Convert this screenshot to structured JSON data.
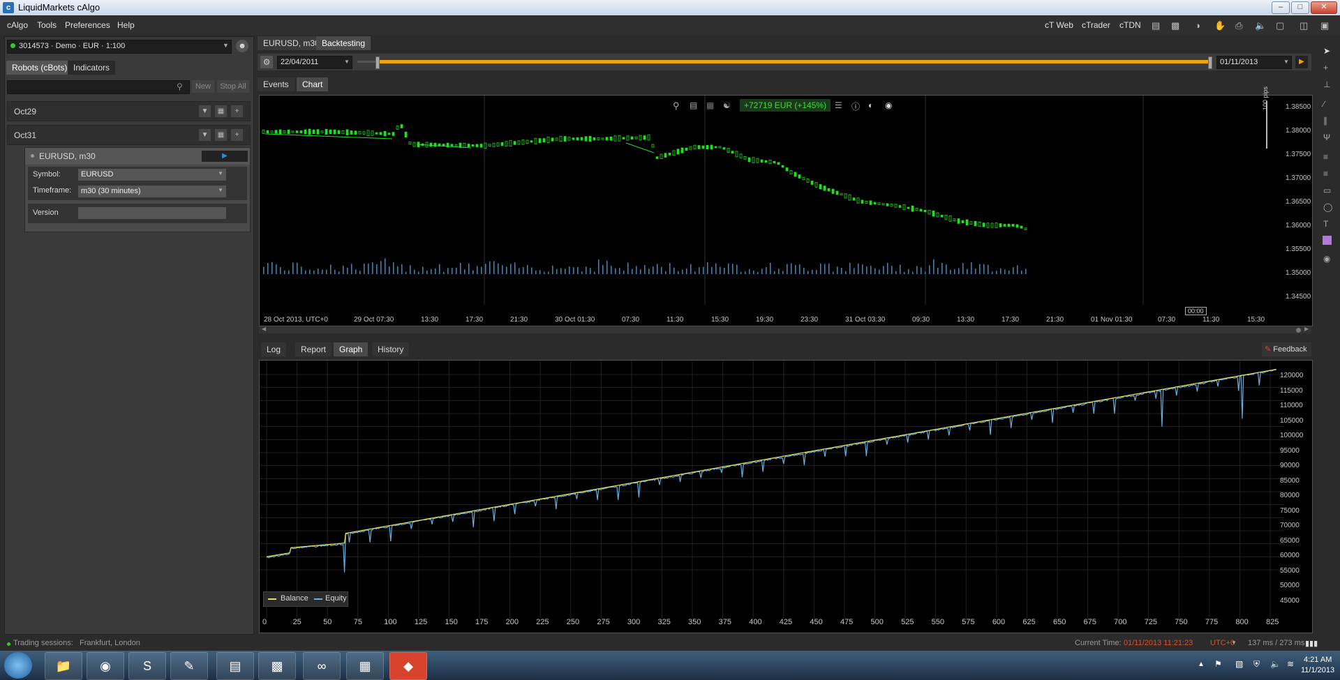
{
  "window": {
    "title": "LiquidMarkets cAlgo",
    "minimize": "–",
    "maximize": "□",
    "close": "✕"
  },
  "menu": {
    "items": [
      "cAlgo",
      "Tools",
      "Preferences",
      "Help"
    ],
    "right_links": [
      "cT Web",
      "cTrader",
      "cTDN"
    ]
  },
  "account": {
    "selector": "3014573 · Demo · EUR · 1:100"
  },
  "left_tabs": [
    "Robots (cBots)",
    "Indicators"
  ],
  "left_toolbar": {
    "search_placeholder": "",
    "new": "New",
    "stop_all": "Stop All"
  },
  "robots": [
    {
      "name": "Oct29"
    },
    {
      "name": "Oct31",
      "instance": {
        "title": "EURUSD, m30",
        "params": [
          {
            "label": "Symbol:",
            "value": "EURUSD"
          },
          {
            "label": "Timeframe:",
            "value": "m30 (30 minutes)"
          }
        ],
        "version_label": "Version",
        "version_value": ""
      }
    }
  ],
  "doc_tabs": [
    "EURUSD, m30",
    "Backtesting"
  ],
  "backtest": {
    "start_date": "22/04/2011",
    "end_date": "01/11/2013",
    "progress": 1.0,
    "accent": "#f0a30a"
  },
  "view_tabs": [
    "Events",
    "Chart"
  ],
  "chart": {
    "profit_badge": "+72719 EUR (+145%)",
    "pips_label": "100 pips",
    "price_labels": [
      "1.38500",
      "1.38000",
      "1.37500",
      "1.37000",
      "1.36500",
      "1.36000",
      "1.35500",
      "1.35000",
      "1.34500"
    ],
    "time_labels": [
      "28 Oct 2013, UTC+0",
      "29 Oct 07:30",
      "13:30",
      "17:30",
      "21:30",
      "30 Oct 01:30",
      "07:30",
      "11:30",
      "15:30",
      "19:30",
      "23:30",
      "31 Oct 03:30",
      "09:30",
      "13:30",
      "17:30",
      "21:30",
      "01 Nov 01:30",
      "07:30",
      "11:30",
      "15:30"
    ],
    "cursor_time": "00:00",
    "candle_color": "#22dd22",
    "volume_color": "#2b8fd6"
  },
  "bottom_tabs": [
    "Log",
    "Report",
    "Graph",
    "History"
  ],
  "feedback": "Feedback",
  "graph": {
    "y_labels": [
      "120000",
      "115000",
      "110000",
      "105000",
      "100000",
      "95000",
      "90000",
      "85000",
      "80000",
      "75000",
      "70000",
      "65000",
      "60000",
      "55000",
      "50000",
      "45000"
    ],
    "x_labels": [
      "0",
      "25",
      "50",
      "75",
      "100",
      "125",
      "150",
      "175",
      "200",
      "225",
      "250",
      "275",
      "300",
      "325",
      "350",
      "375",
      "400",
      "425",
      "450",
      "475",
      "500",
      "525",
      "550",
      "575",
      "600",
      "625",
      "650",
      "675",
      "700",
      "725",
      "750",
      "775",
      "800",
      "825"
    ],
    "legend": [
      {
        "name": "Balance",
        "color": "#e8e060"
      },
      {
        "name": "Equity",
        "color": "#6ab0e0"
      }
    ]
  },
  "status": {
    "sessions_label": "Trading sessions:",
    "sessions_value": "Frankfurt, London",
    "current_time_label": "Current Time:",
    "current_time_value": "01/11/2013 11:21:23",
    "tz": "UTC+0",
    "latency": "137 ms / 273 ms"
  },
  "taskbar": {
    "time": "4:21 AM",
    "date": "11/1/2013"
  }
}
